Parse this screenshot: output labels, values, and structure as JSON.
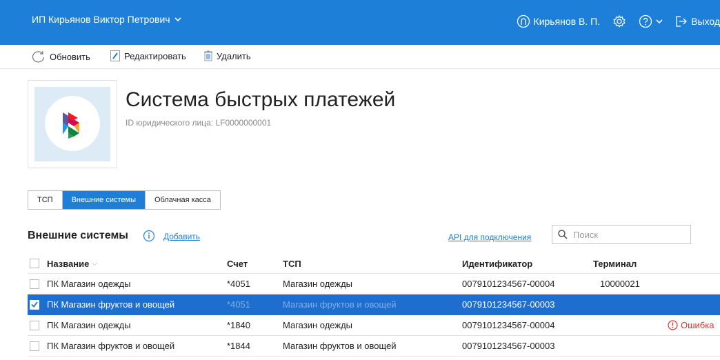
{
  "topbar": {
    "org_name": "ИП Кирьянов Виктор Петрович",
    "user_name": "Кирьянов В. П.",
    "exit_label": "Выход"
  },
  "toolbar": {
    "refresh_label": "Обновить",
    "edit_label": "Редактировать",
    "delete_label": "Удалить"
  },
  "header": {
    "title": "Система быстрых платежей",
    "subtitle": "ID юридического лица: LF0000000001"
  },
  "tabs": [
    {
      "label": "ТСП",
      "active": false
    },
    {
      "label": "Внешние системы",
      "active": true
    },
    {
      "label": "Облачная касса",
      "active": false
    }
  ],
  "section": {
    "title": "Внешние системы",
    "add_label": "Добавить",
    "api_link": "API для подключения",
    "search_placeholder": "Поиск"
  },
  "table": {
    "columns": {
      "name": "Название",
      "account": "Счет",
      "tsp": "ТСП",
      "identifier": "Идентификатор",
      "terminal": "Терминал"
    },
    "rows": [
      {
        "name": "ПК Магазин одежды",
        "account": "*4051",
        "tsp": "Магазин одежды",
        "identifier": "0079101234567-00004",
        "terminal": "10000021",
        "status": "",
        "selected": false
      },
      {
        "name": "ПК Магазин фруктов и овощей",
        "account": "*4051",
        "tsp": "Магазин фруктов и овощей",
        "identifier": "0079101234567-00003",
        "terminal": "",
        "status": "",
        "selected": true
      },
      {
        "name": "ПК Магазин одежды",
        "account": "*1840",
        "tsp": "Магазин одежды",
        "identifier": "0079101234567-00004",
        "terminal": "",
        "status": "Ошибка",
        "selected": false
      },
      {
        "name": "ПК Магазин фруктов и овощей",
        "account": "*1844",
        "tsp": "Магазин фруктов и овощей",
        "identifier": "0079101234567-00003",
        "terminal": "",
        "status": "",
        "selected": false
      }
    ]
  },
  "colors": {
    "accent": "#1e7fd8",
    "selected_row": "#1e6ed0",
    "error": "#e03030"
  }
}
